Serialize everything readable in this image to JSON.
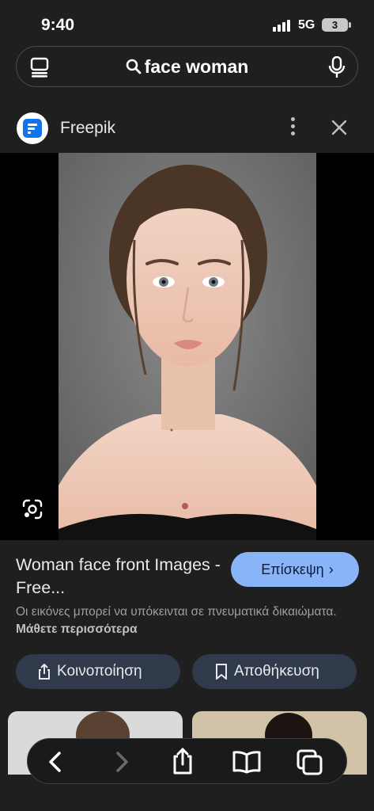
{
  "status_bar": {
    "time": "9:40",
    "network": "5G",
    "battery": "3"
  },
  "search": {
    "query": "face woman",
    "icons": [
      "tabs-icon",
      "search-icon",
      "microphone-icon"
    ]
  },
  "source": {
    "name": "Freepik",
    "icons": [
      "freepik-logo",
      "more-vert-icon",
      "close-icon"
    ]
  },
  "viewer": {
    "icons": [
      "lens-icon"
    ]
  },
  "result": {
    "title": "Woman face front Images - Free...",
    "visit_label": "Επίσκεψη",
    "visit_chevron": "›",
    "copyright_text": "Οι εικόνες μπορεί να υπόκεινται σε πνευματικά δικαιώματα.",
    "learn_more": "Μάθετε περισσότερα"
  },
  "actions": {
    "share_label": "Κοινοποίηση",
    "save_label": "Αποθήκευση"
  },
  "toolbar": {
    "icons": [
      "back-icon",
      "forward-icon",
      "share-icon",
      "bookmarks-icon",
      "tabs-icon"
    ]
  },
  "colors": {
    "background": "#1f1f1f",
    "accent": "#8ab4f8",
    "chip": "#303a4a"
  }
}
